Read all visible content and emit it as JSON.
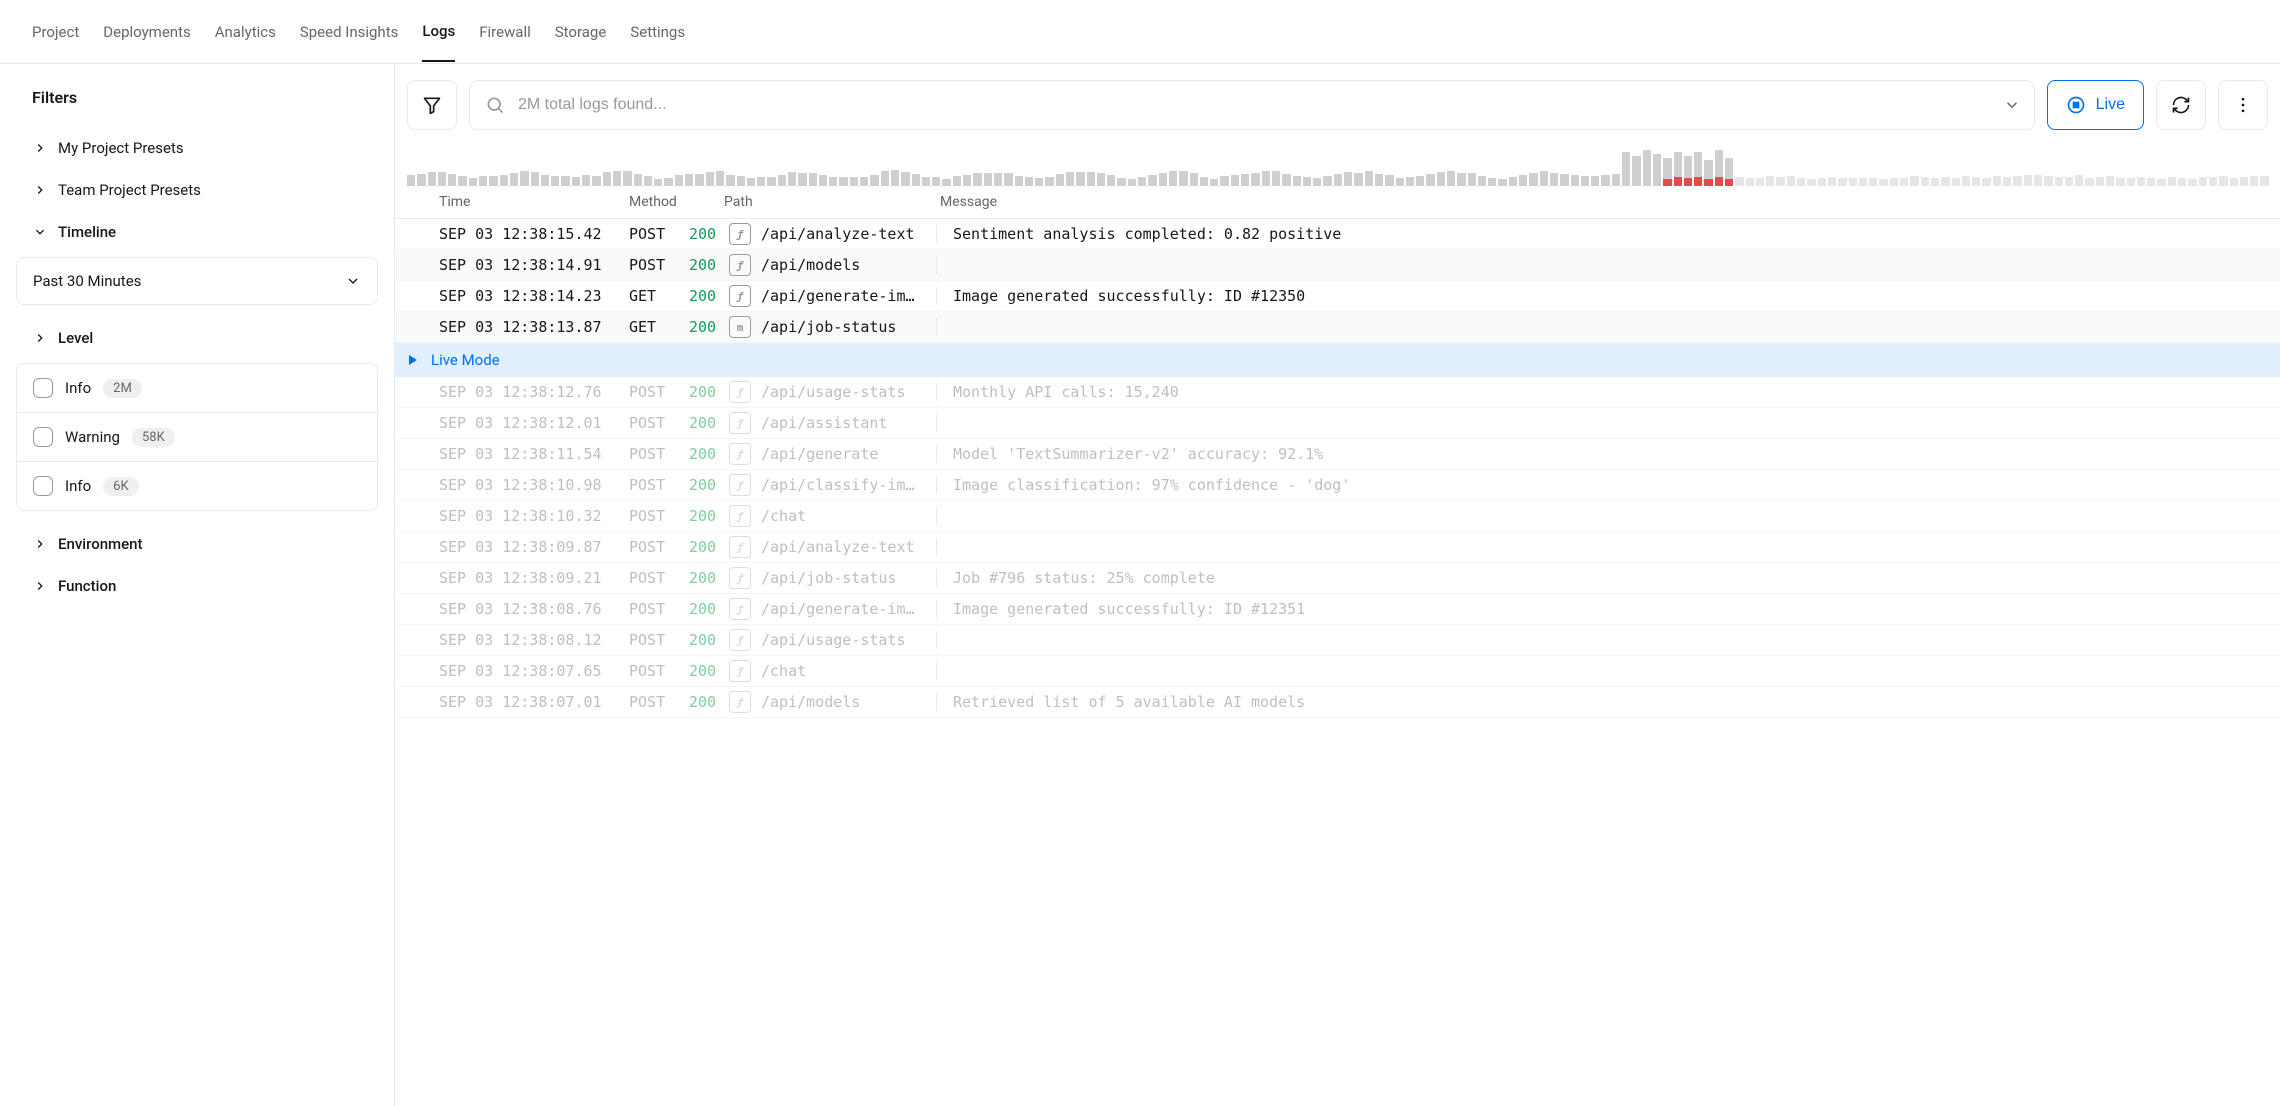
{
  "nav": {
    "items": [
      "Project",
      "Deployments",
      "Analytics",
      "Speed Insights",
      "Logs",
      "Firewall",
      "Storage",
      "Settings"
    ],
    "active_index": 4
  },
  "sidebar": {
    "title": "Filters",
    "presets": [
      "My Project Presets",
      "Team Project Presets"
    ],
    "sections": {
      "timeline": {
        "label": "Timeline",
        "value": "Past 30 Minutes"
      },
      "level": {
        "label": "Level",
        "items": [
          {
            "name": "Info",
            "count": "2M"
          },
          {
            "name": "Warning",
            "count": "58K"
          },
          {
            "name": "Info",
            "count": "6K"
          }
        ]
      },
      "environment": {
        "label": "Environment"
      },
      "function": {
        "label": "Function"
      }
    }
  },
  "toolbar": {
    "search_placeholder": "2M total logs found...",
    "live_label": "Live"
  },
  "histogram": {
    "lead_count": 118,
    "spike": [
      34,
      30,
      36,
      32,
      28,
      34,
      30,
      34,
      26,
      36,
      28
    ],
    "spike_red_from": 4,
    "trail_count": 52
  },
  "log_header": {
    "time": "Time",
    "method": "Method",
    "path": "Path",
    "message": "Message"
  },
  "live_mode_label": "Live Mode",
  "logs": [
    {
      "ts": "SEP 03 12:38:15.42",
      "method": "POST",
      "status": "200",
      "icon": "fn",
      "path": "/api/analyze-text",
      "msg": "Sentiment analysis completed: 0.82 positive",
      "faded": false
    },
    {
      "ts": "SEP 03 12:38:14.91",
      "method": "POST",
      "status": "200",
      "icon": "fn",
      "path": "/api/models",
      "msg": "",
      "faded": false,
      "alt": true
    },
    {
      "ts": "SEP 03 12:38:14.23",
      "method": "GET",
      "status": "200",
      "icon": "fn",
      "path": "/api/generate-im…",
      "msg": "Image generated successfully: ID #12350",
      "faded": false
    },
    {
      "ts": "SEP 03 12:38:13.87",
      "method": "GET",
      "status": "200",
      "icon": "m",
      "path": "/api/job-status",
      "msg": "",
      "faded": false,
      "alt": true
    },
    {
      "ts": "SEP 03 12:38:12.76",
      "method": "POST",
      "status": "200",
      "icon": "fn",
      "path": "/api/usage-stats",
      "msg": "Monthly API calls: 15,240",
      "faded": true
    },
    {
      "ts": "SEP 03 12:38:12.01",
      "method": "POST",
      "status": "200",
      "icon": "fn",
      "path": "/api/assistant",
      "msg": "",
      "faded": true
    },
    {
      "ts": "SEP 03 12:38:11.54",
      "method": "POST",
      "status": "200",
      "icon": "fn",
      "path": "/api/generate",
      "msg": "Model 'TextSummarizer-v2' accuracy: 92.1%",
      "faded": true
    },
    {
      "ts": "SEP 03 12:38:10.98",
      "method": "POST",
      "status": "200",
      "icon": "fn",
      "path": "/api/classify-im…",
      "msg": "Image classification: 97% confidence - 'dog'",
      "faded": true
    },
    {
      "ts": "SEP 03 12:38:10.32",
      "method": "POST",
      "status": "200",
      "icon": "fn",
      "path": "/chat",
      "msg": "",
      "faded": true
    },
    {
      "ts": "SEP 03 12:38:09.87",
      "method": "POST",
      "status": "200",
      "icon": "fn",
      "path": "/api/analyze-text",
      "msg": "",
      "faded": true
    },
    {
      "ts": "SEP 03 12:38:09.21",
      "method": "POST",
      "status": "200",
      "icon": "fn",
      "path": "/api/job-status",
      "msg": "Job #796 status: 25% complete",
      "faded": true
    },
    {
      "ts": "SEP 03 12:38:08.76",
      "method": "POST",
      "status": "200",
      "icon": "fn",
      "path": "/api/generate-im…",
      "msg": "Image generated successfully: ID #12351",
      "faded": true
    },
    {
      "ts": "SEP 03 12:38:08.12",
      "method": "POST",
      "status": "200",
      "icon": "fn",
      "path": "/api/usage-stats",
      "msg": "",
      "faded": true
    },
    {
      "ts": "SEP 03 12:38:07.65",
      "method": "POST",
      "status": "200",
      "icon": "fn",
      "path": "/chat",
      "msg": "",
      "faded": true
    },
    {
      "ts": "SEP 03 12:38:07.01",
      "method": "POST",
      "status": "200",
      "icon": "fn",
      "path": "/api/models",
      "msg": "Retrieved list of 5 available AI models",
      "faded": true
    }
  ]
}
